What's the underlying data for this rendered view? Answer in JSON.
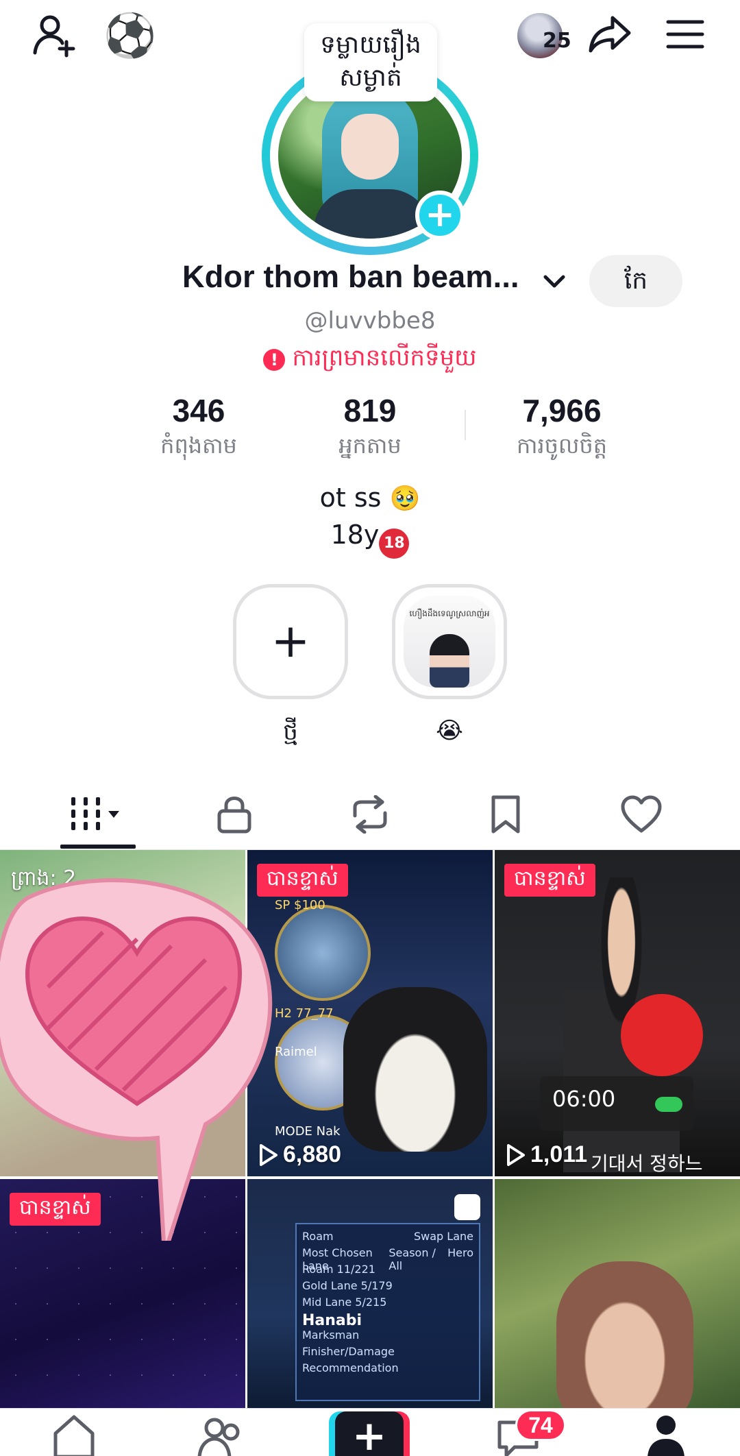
{
  "topbar": {
    "viewer_count": "25"
  },
  "profile": {
    "story_bubble": "ទម្លាយរឿង សម្ងាត់",
    "display_name": "Kdor thom ban beam...",
    "edit_label": "កែ",
    "username": "@luvvbbe8",
    "warning_text": "ការព្រមានលើកទីមួយ",
    "warning_icon": "!"
  },
  "stats": [
    {
      "value": "346",
      "label": "កំពុងតាម"
    },
    {
      "value": "819",
      "label": "អ្នកតាម"
    },
    {
      "value": "7,966",
      "label": "ការចូលចិត្ត"
    }
  ],
  "bio": {
    "line1": "ot ss",
    "line1_emoji": "🥹",
    "line2": "18y",
    "line2_badge": "18"
  },
  "highlights": [
    {
      "label": "ថ្មី",
      "icon": "plus-icon"
    },
    {
      "label": "😭",
      "thumb_text": "ហឿងដឹងទេណូស្រលាញ់អ"
    }
  ],
  "tabs": [
    {
      "name": "videos",
      "icon": "grid-icon",
      "active": true
    },
    {
      "name": "private",
      "icon": "lock-icon"
    },
    {
      "name": "reposts",
      "icon": "repost-icon"
    },
    {
      "name": "favorites",
      "icon": "bookmark-icon"
    },
    {
      "name": "liked",
      "icon": "heart-icon"
    }
  ],
  "videos": [
    {
      "badge": "ព្រាង: 2",
      "type": "drafts"
    },
    {
      "badge": "បានខ្ទាស់",
      "views": "6,880",
      "overlay": {
        "sp": "SP $100",
        "tag": "H2 77_77",
        "name": "Raimel",
        "mode": "MODE Nak"
      }
    },
    {
      "badge": "បានខ្ទាស់",
      "views": "1,011",
      "overlay": {
        "clock": "06:00",
        "subtitle": "기대서 정하느"
      }
    },
    {
      "badge": "បានខ្ទាស់"
    },
    {
      "overlay": {
        "rows": [
          "Roam",
          "Swap Lane",
          "Most Chosen Lane",
          "Season / All",
          "Hero",
          "Roam   11/221",
          "Gold Lane   5/179",
          "Mid Lane   5/215",
          "Hanabi",
          "Marksman",
          "Finisher/Damage",
          "Recommendation"
        ]
      }
    },
    {}
  ],
  "bottom_nav": {
    "inbox_badge": "74"
  },
  "colors": {
    "accent_red": "#fe2c55",
    "accent_cyan": "#20d5ec",
    "text_primary": "#161823",
    "text_secondary": "#7d7f86"
  }
}
